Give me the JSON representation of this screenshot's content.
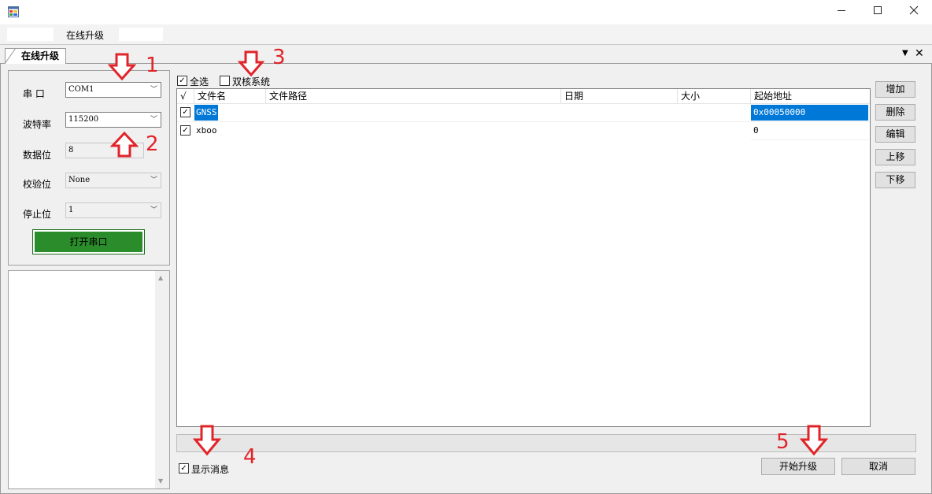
{
  "menu": {
    "online_upgrade": "在线升级"
  },
  "tab": {
    "label": "在线升级"
  },
  "serial": {
    "port_label": "串  口",
    "port_value": "COM1",
    "baud_label": "波特率",
    "baud_value": "115200",
    "databits_label": "数据位",
    "databits_value": "8",
    "parity_label": "校验位",
    "parity_value": "None",
    "stopbits_label": "停止位",
    "stopbits_value": "1",
    "open_button": "打开串口"
  },
  "options": {
    "select_all": "全选",
    "dual_core": "双核系统",
    "show_messages": "显示消息"
  },
  "table": {
    "columns": [
      "√",
      "文件名",
      "文件路径",
      "日期",
      "大小",
      "起始地址"
    ],
    "rows": [
      {
        "checked": true,
        "name": "GNSS",
        "path": "",
        "date": "",
        "size": "",
        "address": "0x00050000"
      },
      {
        "checked": true,
        "name": "xboo",
        "path": "",
        "date": "",
        "size": "",
        "address": "0"
      }
    ]
  },
  "side_buttons": {
    "add": "增加",
    "delete": "删除",
    "edit": "编辑",
    "move_up": "上移",
    "move_down": "下移"
  },
  "bottom_buttons": {
    "start": "开始升级",
    "cancel": "取消"
  },
  "annotations": [
    "1",
    "2",
    "3",
    "4",
    "5"
  ],
  "colors": {
    "open_button": "#2a8c2a",
    "selection": "#0078d7",
    "annotation": "#e0242a"
  }
}
